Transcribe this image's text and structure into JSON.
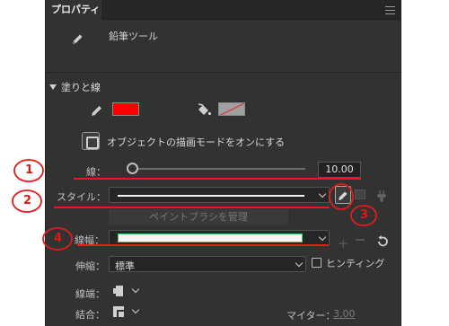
{
  "panel": {
    "tab_label": "プロパティ",
    "tool_name": "鉛筆ツール"
  },
  "fill_stroke": {
    "section_title": "塗りと線",
    "stroke_color": "#ff0000",
    "fill_color": "none",
    "object_draw_label": "オブジェクトの描画モードをオンにする"
  },
  "stroke": {
    "label": "線：",
    "value": "10.00",
    "slider_value_fraction": 0.0
  },
  "style": {
    "label": "スタイル：",
    "manage_brush_button": "ペイントブラシを管理"
  },
  "width": {
    "label": "線幅："
  },
  "scale": {
    "label": "伸縮：",
    "selected": "標準",
    "hinting_label": "ヒンティング",
    "hinting_checked": false
  },
  "cap": {
    "label": "線端："
  },
  "join": {
    "label": "結合："
  },
  "miter": {
    "label": "マイター：",
    "value": "3.00"
  },
  "annotations": {
    "n1": "1",
    "n2": "2",
    "n3": "3",
    "n4": "4",
    "color": "#e21b1b"
  }
}
